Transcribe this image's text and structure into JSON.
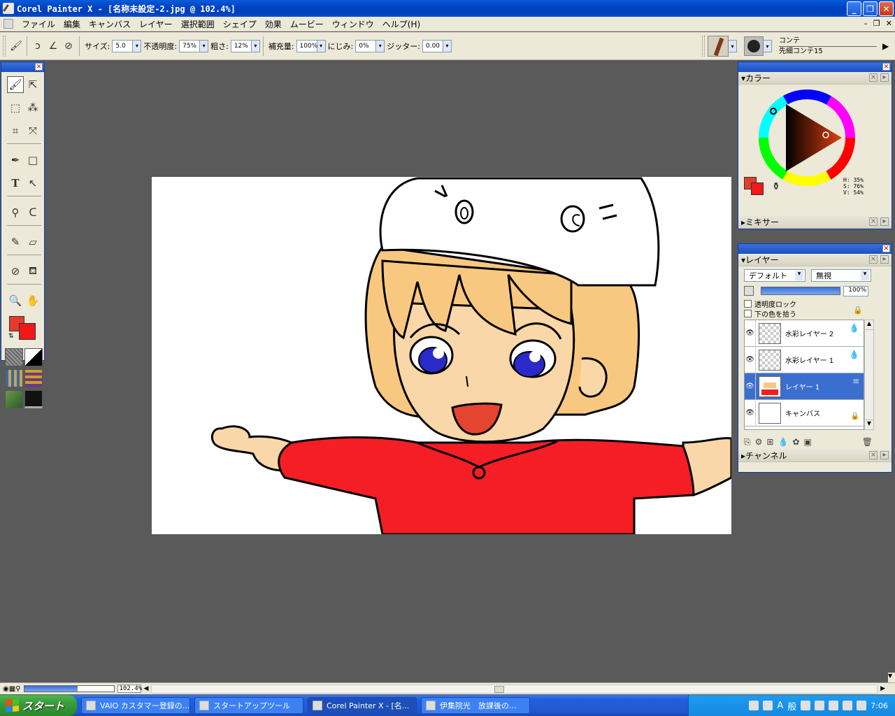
{
  "window": {
    "title": "Corel Painter X - [名称未設定-2.jpg @ 102.4%]"
  },
  "menu": [
    "ファイル",
    "編集",
    "キャンバス",
    "レイヤー",
    "選択範囲",
    "シェイプ",
    "効果",
    "ムービー",
    "ウィンドウ",
    "ヘルプ(H)"
  ],
  "propbar": {
    "size_label": "サイズ:",
    "size_value": "5.0",
    "opacity_label": "不透明度:",
    "opacity_value": "75%",
    "grain_label": "粗さ:",
    "grain_value": "12%",
    "resat_label": "補充量:",
    "resat_value": "100%",
    "bleed_label": "にじみ:",
    "bleed_value": "0%",
    "jitter_label": "ジッター:",
    "jitter_value": "0.00"
  },
  "brush": {
    "category": "コンテ",
    "variant": "先細コンテ15"
  },
  "colors": {
    "main": "#e43c2c",
    "additional": "#f01818",
    "canvas_bg": "#5a5a5a"
  },
  "color_panel": {
    "title": "カラー",
    "hsv": {
      "h": "H: 35%",
      "s": "S: 76%",
      "v": "V: 54%"
    },
    "mixer_label": "ミキサー"
  },
  "layers_panel": {
    "title": "レイヤー",
    "composite_method": "デフォルト",
    "depth": "無視",
    "opacity": "100%",
    "opacity_fraction": 1.0,
    "preserve_transparency": "透明度ロック",
    "pick_up_underlying": "下の色を拾う",
    "layers": [
      {
        "name": "水彩レイヤー 2",
        "badge": "💧"
      },
      {
        "name": "水彩レイヤー 1",
        "badge": "💧"
      },
      {
        "name": "レイヤー 1",
        "badge": "≡"
      },
      {
        "name": "キャンバス",
        "badge": "🔒"
      }
    ],
    "channels_label": "チャンネル"
  },
  "status": {
    "zoom": "102.4%"
  },
  "taskbar": {
    "start": "スタート",
    "tasks": [
      {
        "label": "VAIO カスタマー登録の..."
      },
      {
        "label": "スタートアップツール"
      },
      {
        "label": "Corel Painter X - [名..."
      },
      {
        "label": "伊集院光　放課後の..."
      }
    ],
    "time": "7:06"
  }
}
